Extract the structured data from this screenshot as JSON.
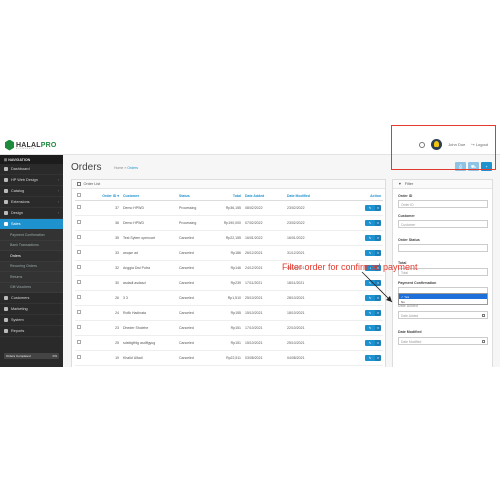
{
  "brand": {
    "name_a": "HALAL",
    "name_b": "PRO",
    "tagline": "ECOMMERCE"
  },
  "header": {
    "user_name": "John Doe",
    "logout_label": "Logout"
  },
  "sidebar": {
    "title": "NAVIGATION",
    "items": [
      {
        "label": "Dashboard",
        "icon": "dashboard-icon",
        "expandable": false
      },
      {
        "label": "HP Web Design",
        "icon": "layout-icon",
        "expandable": true
      },
      {
        "label": "Catalog",
        "icon": "tag-icon",
        "expandable": true
      },
      {
        "label": "Extensions",
        "icon": "puzzle-icon",
        "expandable": true
      },
      {
        "label": "Design",
        "icon": "monitor-icon",
        "expandable": true
      },
      {
        "label": "Sales",
        "icon": "cart-icon",
        "expandable": true,
        "active": true
      }
    ],
    "sales_sub": [
      {
        "label": "Payment Confirmation"
      },
      {
        "label": "Bank Transactions"
      },
      {
        "label": "Orders",
        "active": true
      },
      {
        "label": "Recurring Orders"
      },
      {
        "label": "Returns"
      },
      {
        "label": "Gift Vouchers"
      }
    ],
    "items_after": [
      {
        "label": "Customers",
        "icon": "user-icon"
      },
      {
        "label": "Marketing",
        "icon": "share-icon"
      },
      {
        "label": "System",
        "icon": "gear-icon"
      },
      {
        "label": "Reports",
        "icon": "chart-icon"
      }
    ],
    "progress": {
      "label": "Orders Completed",
      "value": "0%",
      "fraction": 0
    }
  },
  "page": {
    "title": "Orders",
    "breadcrumb_home": "Home",
    "breadcrumb_current": "Orders"
  },
  "order_list": {
    "title": "Order List",
    "columns": [
      "Order ID",
      "Customer",
      "Status",
      "Total",
      "Date Added",
      "Date Modified",
      "Action"
    ],
    "sort_indicator": "▾",
    "rows": [
      {
        "id": "37",
        "customer": "Demo HPWD",
        "status": "Processing",
        "total": "Rp36,155",
        "added": "08/02/2022",
        "modified": "23/02/2022"
      },
      {
        "id": "36",
        "customer": "Demo HPWD",
        "status": "Processing",
        "total": "Rp190,000",
        "added": "07/02/2022",
        "modified": "23/02/2022"
      },
      {
        "id": "35",
        "customer": "Test Sytem opencart",
        "status": "Canceled",
        "total": "Rp22,155",
        "added": "16/01/2022",
        "modified": "16/01/2022"
      },
      {
        "id": "33",
        "customer": "woqse ad",
        "status": "Canceled",
        "total": "Rp186",
        "added": "26/12/2021",
        "modified": "31/12/2021"
      },
      {
        "id": "32",
        "customer": "Anggia Dwi Putra",
        "status": "Canceled",
        "total": "Rp146",
        "added": "24/12/2021",
        "modified": "26/12/2021"
      },
      {
        "id": "30",
        "customer": "asdadl asdasd",
        "status": "Canceled",
        "total": "Rp239",
        "added": "17/11/2021",
        "modified": "18/11/2021"
      },
      {
        "id": "26",
        "customer": "3 3",
        "status": "Canceled",
        "total": "Rp1,510",
        "added": "25/10/2021",
        "modified": "28/10/2021"
      },
      {
        "id": "24",
        "customer": "Rofik Hadinata",
        "status": "Canceled",
        "total": "Rp155",
        "added": "15/10/2021",
        "modified": "18/10/2021"
      },
      {
        "id": "23",
        "customer": "Dheder Sholehe",
        "status": "Canceled",
        "total": "Rp151",
        "added": "17/10/2021",
        "modified": "22/10/2021"
      },
      {
        "id": "25",
        "customer": "sdsfdgffdg asdffgyug",
        "status": "Canceled",
        "total": "Rp151",
        "added": "15/10/2021",
        "modified": "25/10/2021"
      },
      {
        "id": "19",
        "customer": "Khalid Ulfadi",
        "status": "Canceled",
        "total": "Rp22,511",
        "added": "03/08/2021",
        "modified": "04/08/2021"
      }
    ],
    "edit_label": "✎",
    "more_label": "▾"
  },
  "filter": {
    "title": "Filter",
    "order_id_label": "Order ID",
    "order_id_placeholder": "Order ID",
    "customer_label": "Customer",
    "customer_placeholder": "Customer",
    "status_label": "Order Status",
    "total_label": "Total",
    "total_placeholder": "Total",
    "payment_label": "Payment Confirmation",
    "payment_options": [
      "✓ Yes",
      "No"
    ],
    "date_added_label": "Date Added",
    "date_added_placeholder": "Date Added",
    "date_modified_label": "Date Modified",
    "date_modified_placeholder": "Date Modified"
  },
  "annotation": {
    "text": "Filter order for confirmed payment",
    "color": "#e23a2f"
  },
  "colors": {
    "accent": "#1e91cf",
    "sidebar": "#2a2a2a",
    "brand_green": "#1e8a3e"
  }
}
